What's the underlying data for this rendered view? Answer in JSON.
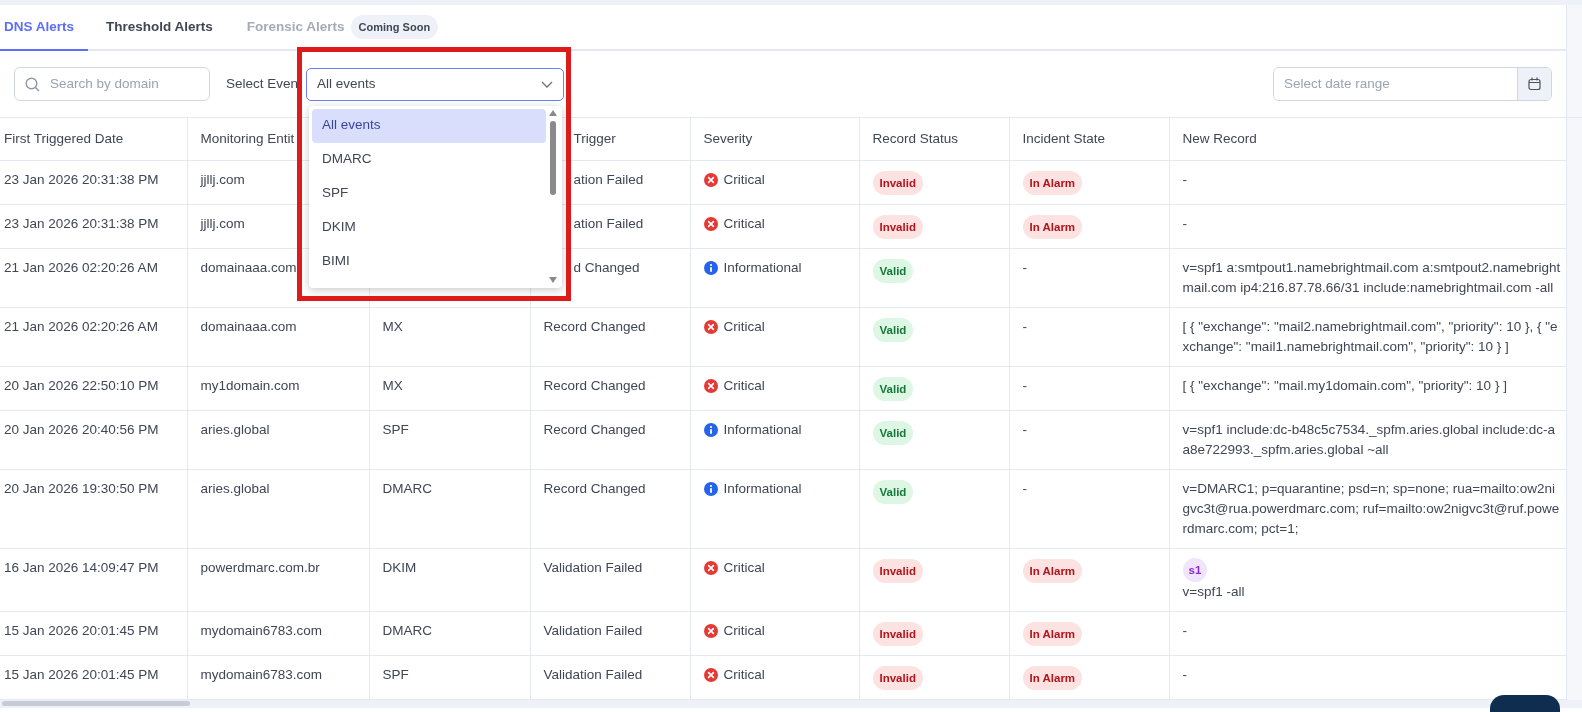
{
  "tabs": [
    {
      "label": "DNS Alerts",
      "selected": true,
      "disabled": false
    },
    {
      "label": "Threshold Alerts",
      "selected": false,
      "disabled": false
    },
    {
      "label": "Forensic Alerts",
      "selected": false,
      "disabled": true,
      "badge": "Coming Soon"
    }
  ],
  "toolbar": {
    "search": {
      "placeholder": "Search by domain"
    },
    "event_label": "Select Even",
    "event_select": {
      "value": "All events",
      "expanded": true,
      "options": [
        {
          "label": "All events",
          "selected": true
        },
        {
          "label": "DMARC",
          "selected": false
        },
        {
          "label": "SPF",
          "selected": false
        },
        {
          "label": "DKIM",
          "selected": false
        },
        {
          "label": "BIMI",
          "selected": false
        }
      ]
    },
    "date_range": {
      "placeholder": "Select date range"
    }
  },
  "table": {
    "columns": [
      "First Triggered Date",
      "Monitoring Entit",
      null,
      "Trigger",
      "Severity",
      "Record Status",
      "Incident State",
      "New Record"
    ],
    "rows": [
      {
        "date": "23 Jan 2026 20:31:38 PM",
        "entity": "jjllj.com",
        "record_type": null,
        "trigger": "ation Failed",
        "severity": {
          "kind": "critical",
          "label": "Critical"
        },
        "record_status": {
          "kind": "invalid",
          "label": "Invalid"
        },
        "incident_state": {
          "kind": "alarm",
          "label": "In Alarm"
        },
        "new_record": {
          "text": "-"
        }
      },
      {
        "date": "23 Jan 2026 20:31:38 PM",
        "entity": "jjllj.com",
        "record_type": null,
        "trigger": "ation Failed",
        "severity": {
          "kind": "critical",
          "label": "Critical"
        },
        "record_status": {
          "kind": "invalid",
          "label": "Invalid"
        },
        "incident_state": {
          "kind": "alarm",
          "label": "In Alarm"
        },
        "new_record": {
          "text": "-"
        }
      },
      {
        "date": "21 Jan 2026 02:20:26 AM",
        "entity": "domainaaa.com",
        "record_type": null,
        "trigger": "d Changed",
        "severity": {
          "kind": "informational",
          "label": "Informational"
        },
        "record_status": {
          "kind": "valid",
          "label": "Valid"
        },
        "incident_state": {
          "kind": "plain",
          "label": "-"
        },
        "new_record": {
          "text": "v=spf1 a:smtpout1.namebrightmail.com a:smtpout2.namebrightmail.com ip4:216.87.78.66/31 include:namebrightmail.com -all"
        }
      },
      {
        "date": "21 Jan 2026 02:20:26 AM",
        "entity": "domainaaa.com",
        "record_type": "MX",
        "trigger": "Record Changed",
        "severity": {
          "kind": "critical",
          "label": "Critical"
        },
        "record_status": {
          "kind": "valid",
          "label": "Valid"
        },
        "incident_state": {
          "kind": "plain",
          "label": "-"
        },
        "new_record": {
          "text": "[ { \"exchange\": \"mail2.namebrightmail.com\", \"priority\": 10 }, { \"exchange\": \"mail1.namebrightmail.com\", \"priority\": 10 } ]"
        }
      },
      {
        "date": "20 Jan 2026 22:50:10 PM",
        "entity": "my1domain.com",
        "record_type": "MX",
        "trigger": "Record Changed",
        "severity": {
          "kind": "critical",
          "label": "Critical"
        },
        "record_status": {
          "kind": "valid",
          "label": "Valid"
        },
        "incident_state": {
          "kind": "plain",
          "label": "-"
        },
        "new_record": {
          "text": "[ { \"exchange\": \"mail.my1domain.com\", \"priority\": 10 } ]"
        }
      },
      {
        "date": "20 Jan 2026 20:40:56 PM",
        "entity": "aries.global",
        "record_type": "SPF",
        "trigger": "Record Changed",
        "severity": {
          "kind": "informational",
          "label": "Informational"
        },
        "record_status": {
          "kind": "valid",
          "label": "Valid"
        },
        "incident_state": {
          "kind": "plain",
          "label": "-"
        },
        "new_record": {
          "text": "v=spf1 include:dc-b48c5c7534._spfm.aries.global include:dc-aa8e722993._spfm.aries.global ~all"
        }
      },
      {
        "date": "20 Jan 2026 19:30:50 PM",
        "entity": "aries.global",
        "record_type": "DMARC",
        "trigger": "Record Changed",
        "severity": {
          "kind": "informational",
          "label": "Informational"
        },
        "record_status": {
          "kind": "valid",
          "label": "Valid"
        },
        "incident_state": {
          "kind": "plain",
          "label": "-"
        },
        "new_record": {
          "text": "v=DMARC1; p=quarantine; psd=n; sp=none; rua=mailto:ow2nigvc3t@rua.powerdmarc.com; ruf=mailto:ow2nigvc3t@ruf.powerdmarc.com; pct=1;"
        }
      },
      {
        "date": "16 Jan 2026 14:09:47 PM",
        "entity": "powerdmarc.com.br",
        "record_type": "DKIM",
        "trigger": "Validation Failed",
        "severity": {
          "kind": "critical",
          "label": "Critical"
        },
        "record_status": {
          "kind": "invalid",
          "label": "Invalid"
        },
        "incident_state": {
          "kind": "alarm",
          "label": "In Alarm"
        },
        "new_record": {
          "tag": "s1",
          "text": "v=spf1 -all"
        }
      },
      {
        "date": "15 Jan 2026 20:01:45 PM",
        "entity": "mydomain6783.com",
        "record_type": "DMARC",
        "trigger": "Validation Failed",
        "severity": {
          "kind": "critical",
          "label": "Critical"
        },
        "record_status": {
          "kind": "invalid",
          "label": "Invalid"
        },
        "incident_state": {
          "kind": "alarm",
          "label": "In Alarm"
        },
        "new_record": {
          "text": "-"
        }
      },
      {
        "date": "15 Jan 2026 20:01:45 PM",
        "entity": "mydomain6783.com",
        "record_type": "SPF",
        "trigger": "Validation Failed",
        "severity": {
          "kind": "critical",
          "label": "Critical"
        },
        "record_status": {
          "kind": "invalid",
          "label": "Invalid"
        },
        "incident_state": {
          "kind": "alarm",
          "label": "In Alarm"
        },
        "new_record": {
          "text": "-"
        }
      }
    ]
  }
}
